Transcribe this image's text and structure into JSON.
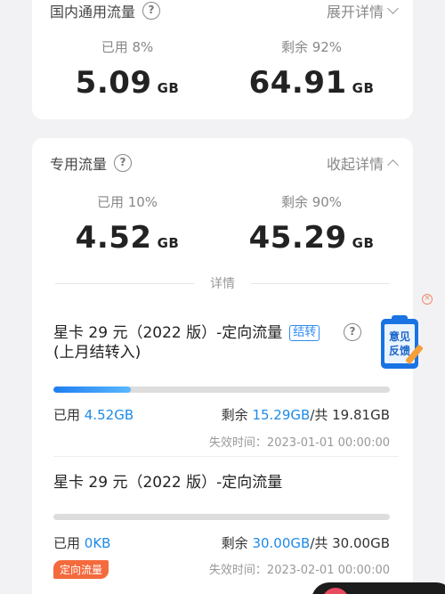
{
  "domestic": {
    "title": "国内通用流量",
    "toggle": "展开详情",
    "used_label": "已用 8%",
    "used_value": "5.09",
    "remain_label": "剩余 92%",
    "remain_value": "64.91",
    "unit": "GB"
  },
  "dedicated": {
    "title": "专用流量",
    "toggle": "收起详情",
    "used_label": "已用 10%",
    "used_value": "4.52",
    "remain_label": "剩余 90%",
    "remain_value": "45.29",
    "unit": "GB",
    "details_label": "详情"
  },
  "items": [
    {
      "title_line1": "星卡 29 元（2022 版）-定向流量",
      "tag": "结转",
      "title_line2": "(上月结转入)",
      "progress": 0.23,
      "used_prefix": "已用",
      "used_value": "4.52GB",
      "remain_prefix": "剩余",
      "remain_value": "15.29GB",
      "total": "/共 19.81GB",
      "expiry": "失效时间：2023-01-01 00:00:00"
    },
    {
      "title_line1": "星卡 29 元（2022 版）-定向流量",
      "progress": 0.0,
      "used_prefix": "已用",
      "used_value": "0KB",
      "remain_prefix": "剩余",
      "remain_value": "30.00GB",
      "total": "/共 30.00GB",
      "badge": "定向流量",
      "expiry": "失效时间：2023-02-01 00:00:00"
    }
  ],
  "feedback": {
    "label": "意见反馈",
    "close": "×"
  },
  "colors": {
    "accent": "#1f8ae6",
    "badge": "#f46a3d",
    "progress": "#1e7ef0"
  }
}
